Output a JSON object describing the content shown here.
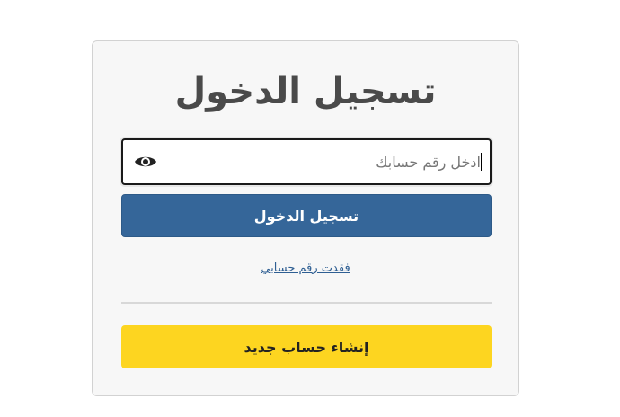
{
  "login_form": {
    "title": "تسجيل الدخول",
    "account_field": {
      "value": "",
      "placeholder": "ادخل رقم حسابك",
      "toggle_icon": "eye-icon"
    },
    "login_button_label": "تسجيل الدخول",
    "forgot_link_label": "فقدت رقم حسابي",
    "create_account_button_label": "إنشاء حساب جديد"
  },
  "colors": {
    "primary_button": "#356699",
    "secondary_button": "#fdd520",
    "link": "#2f5f93",
    "title": "#4a4a4a"
  }
}
